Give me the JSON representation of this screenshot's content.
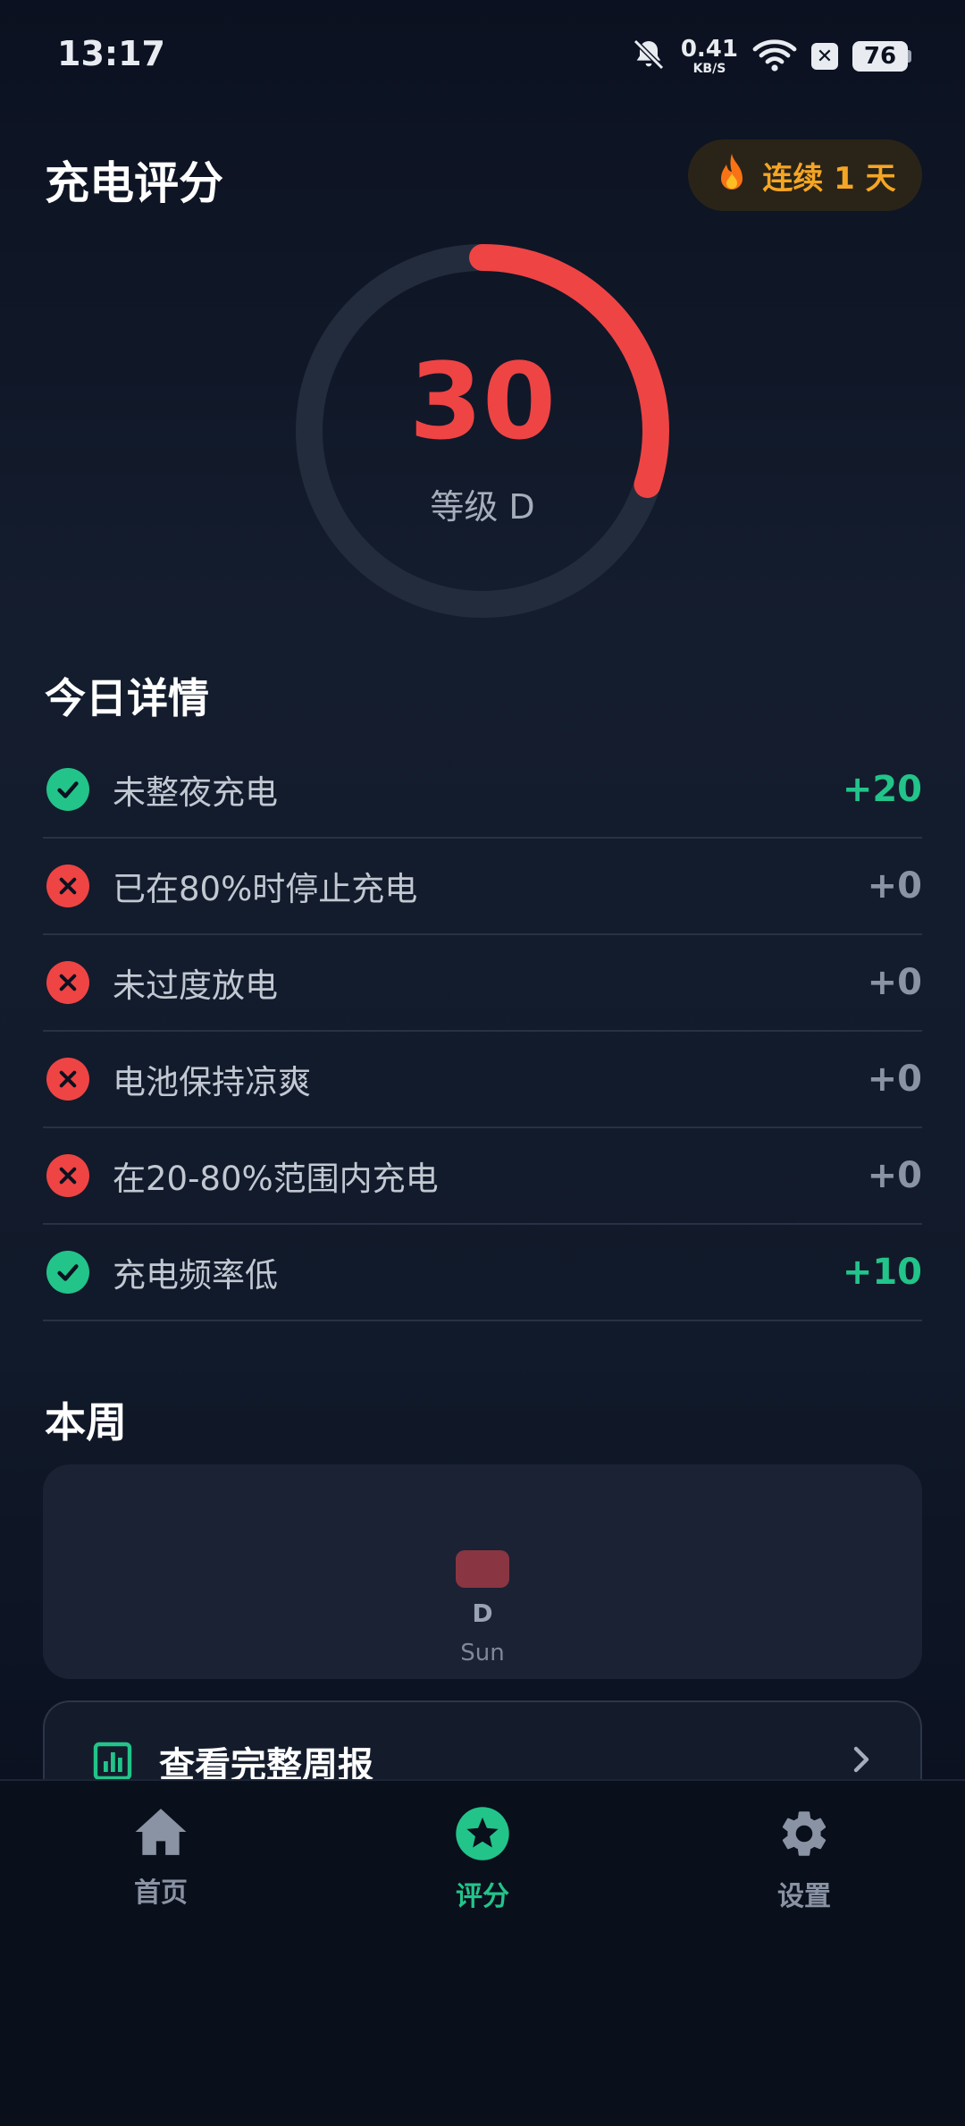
{
  "status_bar": {
    "time": "13:17",
    "net_speed": "0.41",
    "net_unit": "KB/S",
    "battery": "76"
  },
  "header": {
    "title": "充电评分",
    "streak_label": "连续 1 天"
  },
  "score": {
    "value": "30",
    "grade_label": "等级 D",
    "progress": 0.3,
    "ring_color": "#ef4444"
  },
  "today": {
    "title": "今日详情",
    "items": [
      {
        "label": "未整夜充电",
        "points": "+20",
        "passed": true
      },
      {
        "label": "已在80%时停止充电",
        "points": "+0",
        "passed": false
      },
      {
        "label": "未过度放电",
        "points": "+0",
        "passed": false
      },
      {
        "label": "电池保持凉爽",
        "points": "+0",
        "passed": false
      },
      {
        "label": "在20-80%范围内充电",
        "points": "+0",
        "passed": false
      },
      {
        "label": "充电频率低",
        "points": "+10",
        "passed": true
      }
    ]
  },
  "week": {
    "title": "本周",
    "days": [
      {
        "grade": "D",
        "day": "Sun"
      }
    ],
    "report_label": "查看完整周报"
  },
  "nav": {
    "items": [
      {
        "label": "首页",
        "icon": "home-icon",
        "active": false
      },
      {
        "label": "评分",
        "icon": "star-icon",
        "active": true
      },
      {
        "label": "设置",
        "icon": "gear-icon",
        "active": false
      }
    ]
  },
  "colors": {
    "accent_green": "#22c489",
    "danger_red": "#ef4444",
    "streak_orange": "#f5a524"
  }
}
